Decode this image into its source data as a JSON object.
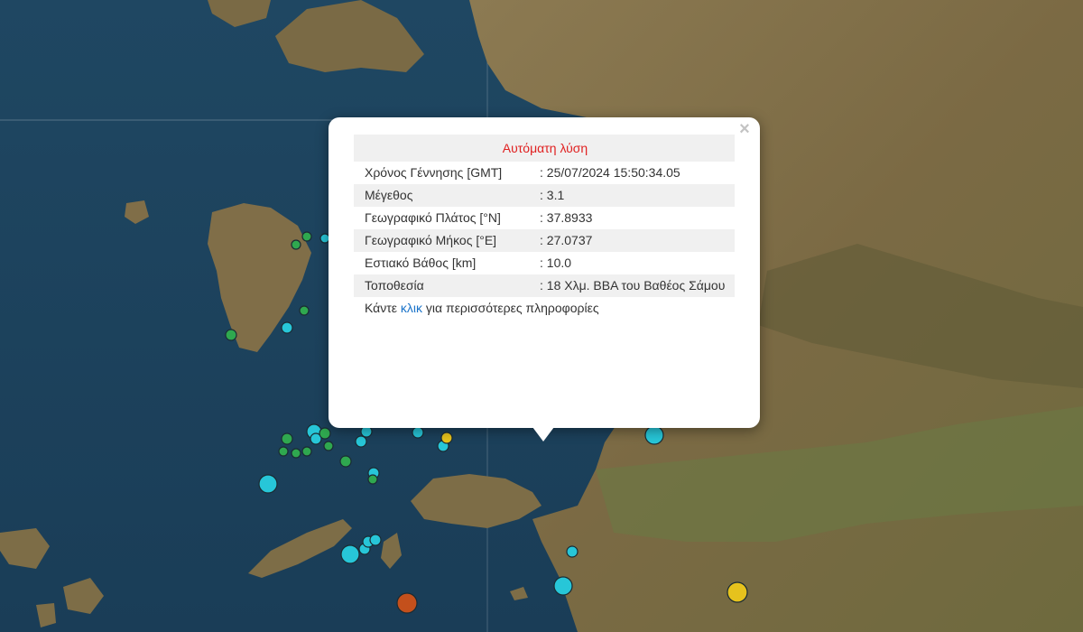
{
  "popup": {
    "header": "Αυτόματη λύση",
    "rows": [
      {
        "label": "Χρόνος Γέννησης [GMT]",
        "value": ": 25/07/2024 15:50:34.05"
      },
      {
        "label": "Μέγεθος",
        "value": ": 3.1"
      },
      {
        "label": "Γεωγραφικό Πλάτος [°N]",
        "value": ": 37.8933"
      },
      {
        "label": "Γεωγραφικό Μήκος [°E]",
        "value": ": 27.0737"
      },
      {
        "label": "Εστιακό Βάθος [km]",
        "value": ": 10.0"
      },
      {
        "label": "Τοποθεσία",
        "value": ": 18 Χλμ. ΒΒΑ του Βαθέος Σάμου"
      }
    ],
    "more_prefix": "Κάντε ",
    "more_link": "κλικ",
    "more_suffix": " για περισσότερες πληροφορίες",
    "close_label": "×"
  },
  "colors": {
    "sea": "#1e4560",
    "land": "#7c6a45",
    "marker_green": "#2fa84f",
    "marker_cyan": "#27c6d8",
    "marker_yellow": "#e6c21d",
    "marker_orange": "#c4501c",
    "popup_header_text": "#e02020",
    "link": "#1a73c9"
  },
  "markers": {
    "legend_note": ""
  }
}
